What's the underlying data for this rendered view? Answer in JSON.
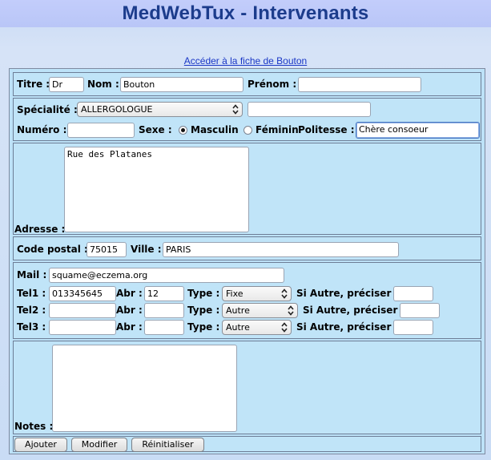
{
  "app_title": "MedWebTux - Intervenants",
  "link_text": "Accéder à la fiche de Bouton",
  "identity": {
    "titre_label": "Titre :",
    "titre_value": "Dr",
    "nom_label": "Nom :",
    "nom_value": "Bouton",
    "prenom_label": "Prénom :",
    "prenom_value": ""
  },
  "specialty": {
    "label": "Spécialité :",
    "selected": "ALLERGOLOGUE",
    "extra_value": "",
    "numero_label": "Numéro :",
    "numero_value": "",
    "sexe_label": "Sexe :",
    "masculin_label": "Masculin",
    "feminin_label": "Féminin",
    "politesse_label": "Politesse :",
    "politesse_value": "Chère consoeur"
  },
  "address": {
    "label": "Adresse :",
    "value": "Rue des Platanes"
  },
  "location": {
    "cp_label": "Code postal :",
    "cp_value": "75015",
    "ville_label": "Ville :",
    "ville_value": "PARIS"
  },
  "contact": {
    "mail_label": "Mail :",
    "mail_value": "squame@eczema.org",
    "abr_label": "Abr :",
    "type_label": "Type :",
    "autre_label": "Si Autre, préciser :",
    "tel1_label": "Tel1 :",
    "tel1_value": "013345645",
    "tel1_abr": "12",
    "tel1_type": "Fixe",
    "tel1_autre": "",
    "tel2_label": "Tel2 :",
    "tel2_value": "",
    "tel2_abr": "",
    "tel2_type": "Autre",
    "tel2_autre": "",
    "tel3_label": "Tel3 :",
    "tel3_value": "",
    "tel3_abr": "",
    "tel3_type": "Autre",
    "tel3_autre": ""
  },
  "notes": {
    "label": "Notes :",
    "value": ""
  },
  "buttons": {
    "add": "Ajouter",
    "modify": "Modifier",
    "reset": "Réinitialiser"
  }
}
